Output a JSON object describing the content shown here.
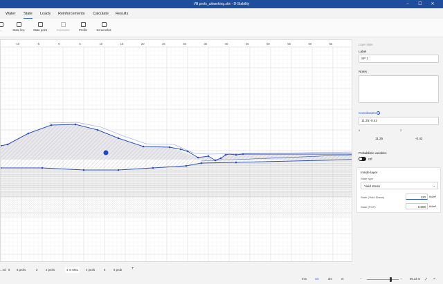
{
  "window": {
    "title": "VB profs_uitwerking.stix - D-Stability",
    "min": "–",
    "max": "☐",
    "close": "✕"
  },
  "menu": {
    "tabs": [
      "Water",
      "State",
      "Loads",
      "Reinforcements",
      "Calculate",
      "Results"
    ],
    "active": "State"
  },
  "toolbar": {
    "items": [
      {
        "label": "...",
        "disabled": false
      },
      {
        "label": "State line",
        "disabled": false
      },
      {
        "label": "State point",
        "disabled": false
      },
      {
        "label": "Constants",
        "disabled": true
      },
      {
        "label": "Profile",
        "disabled": false
      },
      {
        "label": "Screenshot",
        "disabled": false
      }
    ]
  },
  "canvas": {
    "ruler_ticks": [
      "-10",
      "-5",
      "0",
      "5",
      "10",
      "15",
      "20",
      "25",
      "30",
      "35",
      "40",
      "45",
      "50",
      "55",
      "60",
      "65"
    ]
  },
  "panel": {
    "section_header": "Layer state",
    "label_caption": "Label",
    "label_value": "SP 1",
    "notes_caption": "Notes",
    "notes_value": "",
    "coordinates_caption": "Coordinates",
    "coordinates_info_icon": "info-icon",
    "coordinates_value": "11.25;-0.42",
    "x_caption": "x",
    "z_caption": "z",
    "x_value": "11.25",
    "z_value": "-0.42",
    "probabilistic_caption": "Probabilistic variables",
    "probabilistic_state": "Off",
    "inside_layer_caption": "Inside layer",
    "state_type_caption": "State type",
    "state_type_value": "Yield stress",
    "yield_caption": "State (Yield Stress)",
    "yield_value": "120",
    "yield_unit": "kN/m²",
    "pop_caption": "State (POP)",
    "pop_value": "0.000",
    "pop_unit": "kN/m²",
    "accent": "#2b5cc5"
  },
  "status": {
    "tabs": [
      "...ed",
      "6",
      "6 profs",
      "2",
      "2 profs",
      "4 m MSL",
      "4 profs",
      "6",
      "6 prob"
    ],
    "active_tab": "4 m MSL",
    "add_tab": "+",
    "units": [
      "mm",
      "cm",
      "dm",
      "m"
    ],
    "active_unit": "cm",
    "zoom": "95.33 m",
    "fit_icon": "fit-icon",
    "undo_icon": "undo-icon"
  }
}
